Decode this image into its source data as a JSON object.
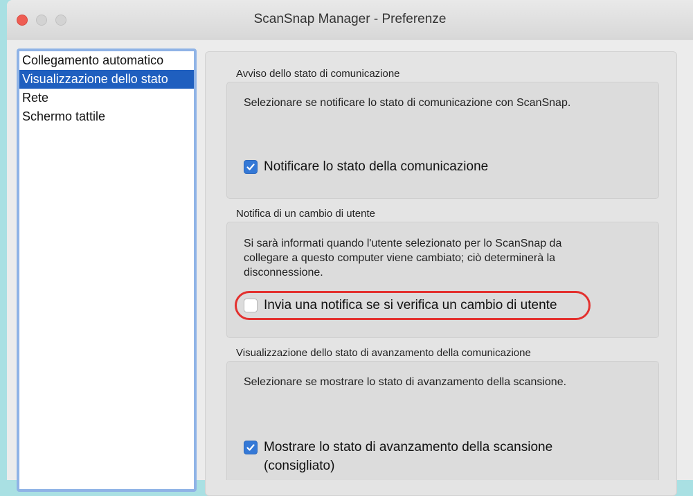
{
  "window": {
    "title": "ScanSnap Manager - Preferenze"
  },
  "sidebar": {
    "items": [
      {
        "label": "Collegamento automatico",
        "selected": false
      },
      {
        "label": "Visualizzazione dello stato",
        "selected": true
      },
      {
        "label": "Rete",
        "selected": false
      },
      {
        "label": "Schermo tattile",
        "selected": false
      }
    ]
  },
  "sections": [
    {
      "label": "Avviso dello stato di comunicazione",
      "description": "Selezionare se notificare lo stato di comunicazione con ScanSnap.",
      "checkbox": {
        "label": "Notificare lo stato della comunicazione",
        "checked": true
      }
    },
    {
      "label": "Notifica di un cambio di utente",
      "description_lines": [
        "Si sarà informati quando l'utente selezionato per lo ScanSnap da",
        "collegare a questo computer viene cambiato; ciò determinerà la",
        "disconnessione."
      ],
      "checkbox": {
        "label": "Invia una notifica se si verifica un cambio di utente",
        "checked": false
      }
    },
    {
      "label": "Visualizzazione dello stato di avanzamento della comunicazione",
      "description": "Selezionare se mostrare lo stato di avanzamento della scansione.",
      "checkbox": {
        "label_lines": [
          "Mostrare lo stato di avanzamento della scansione",
          "(consigliato)"
        ],
        "checked": true
      }
    }
  ],
  "colors": {
    "background": "#a9e0e3",
    "selection": "#1f5fbf",
    "checkbox_on": "#3478d6",
    "highlight": "#e3312f"
  }
}
